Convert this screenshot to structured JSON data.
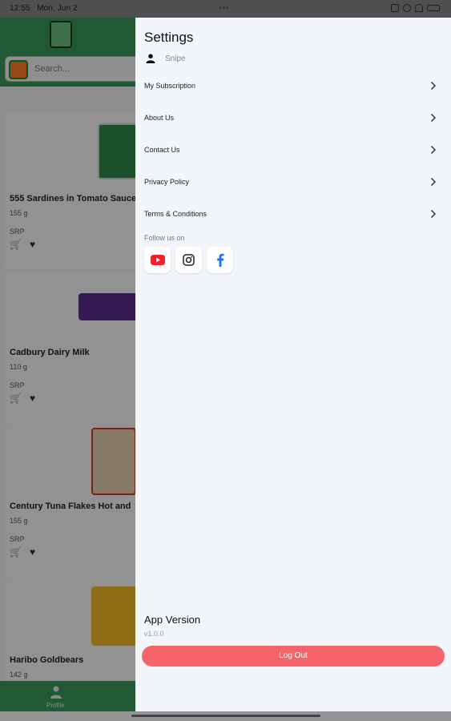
{
  "status_bar": {
    "time": "12:55",
    "date": "Mon, Jun 2",
    "more_indicator": "•••"
  },
  "background": {
    "search_placeholder": "Search...",
    "products": [
      {
        "name": "555 Sardines in Tomato Sauce",
        "weight": "155 g",
        "price_label": "SRP"
      },
      {
        "name": "Cadbury Dairy Milk",
        "weight": "110 g",
        "price_label": "SRP"
      },
      {
        "name": "Century Tuna Flakes Hot and",
        "weight": "155 g",
        "price_label": "SRP"
      },
      {
        "name": "Haribo Goldbears",
        "weight": "142 g",
        "price_label": "SRP"
      }
    ],
    "nav": {
      "profile_label": "Profile"
    }
  },
  "drawer": {
    "title": "Settings",
    "user_name": "Snipe",
    "menu_items": [
      {
        "label": "My Subscription"
      },
      {
        "label": "About Us"
      },
      {
        "label": "Contact Us"
      },
      {
        "label": "Privacy Policy"
      },
      {
        "label": "Terms & Conditions"
      }
    ],
    "follow_label": "Follow us on",
    "socials": [
      {
        "name": "youtube-icon",
        "color": "#f21f2c"
      },
      {
        "name": "instagram-icon",
        "color": "#222222"
      },
      {
        "name": "facebook-icon",
        "color": "#1a77f2"
      }
    ],
    "app_version_label": "App Version",
    "app_version_value": "v1.0.0",
    "logout_label": "Log Out"
  },
  "colors": {
    "brand_green": "#3a9a5c",
    "logout_red": "#f7636b",
    "drawer_bg": "#f2f5f9"
  }
}
